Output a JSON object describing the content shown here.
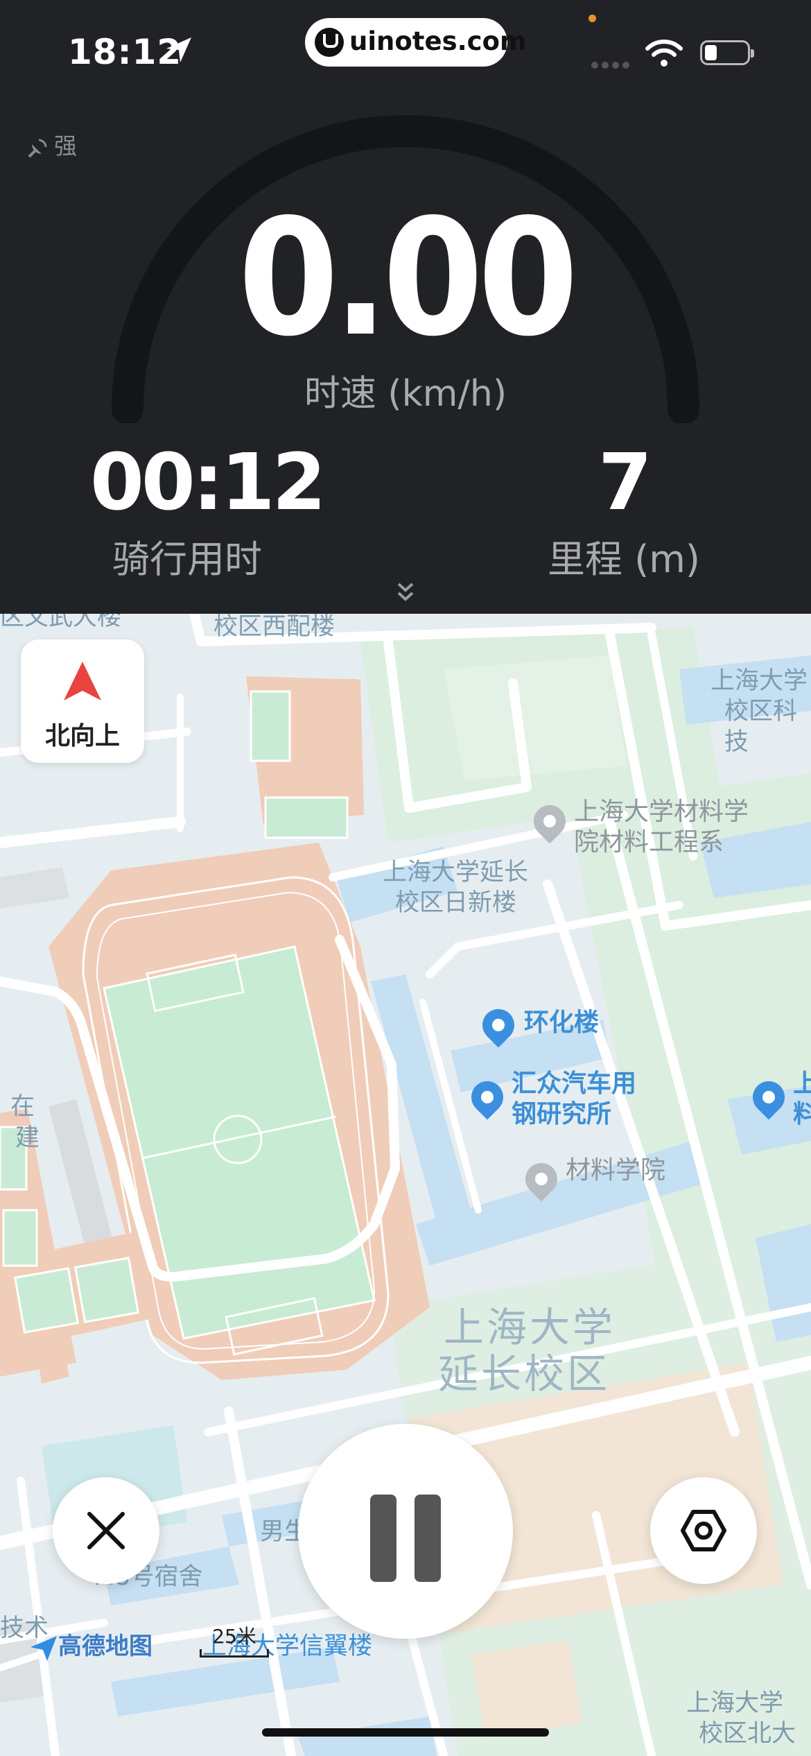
{
  "status_bar": {
    "time": "18:12",
    "url": "uinotes.com"
  },
  "gps": {
    "strength_label": "强"
  },
  "speed": {
    "value": "0.00",
    "label": "时速 (km/h)"
  },
  "stats": {
    "duration": {
      "value": "00:12",
      "label": "骑行用时"
    },
    "distance": {
      "value": "7",
      "label": "里程 (m)"
    }
  },
  "map": {
    "north_button_label": "北向上",
    "labels": {
      "west_building": "校区西配楼",
      "wuwu": "区文武大楼",
      "tech_top_right_1": "上海大学",
      "tech_top_right_2": "校区科技",
      "rixin_1": "上海大学延长",
      "rixin_2": "校区日新楼",
      "zai": "在",
      "jian": "建",
      "campus_1": "上海大学",
      "campus_2": "延长校区",
      "dorm": "M8号宿舍",
      "male": "男生",
      "tech_left": "技术",
      "north_1": "上海大学",
      "north_2": "校区北大",
      "xinyi": "上海大学信翼楼"
    },
    "pois": {
      "materials_engineering_1": "上海大学材料学",
      "materials_engineering_2": "院材料工程系",
      "huanhua": "环化楼",
      "huizhong_1": "汇众汽车用",
      "huizhong_2": "钢研究所",
      "materials_college": "材料学院",
      "right_edge_1": "上",
      "right_edge_2": "料"
    },
    "attribution": "高德地图",
    "scale_label": "25米"
  },
  "controls": {
    "close_icon": "close-icon",
    "pause_icon": "pause-icon",
    "settings_icon": "hexagon-settings-icon"
  },
  "colors": {
    "top_background": "#202226",
    "gauge_track": "#141519",
    "route": "#ffffff",
    "north_arrow": "#e8433e",
    "poi_blue": "#3b8fe0"
  }
}
